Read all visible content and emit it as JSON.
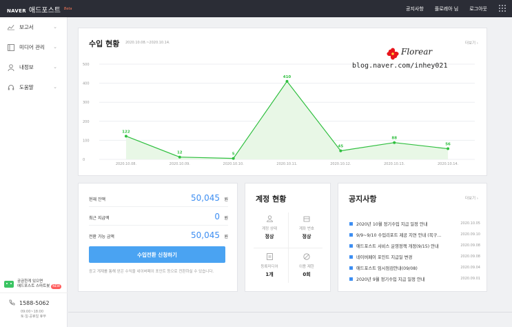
{
  "header": {
    "brand_naver": "NAVER",
    "brand_service": "애드포스트",
    "brand_beta": "Beta",
    "nav": [
      "공지사항",
      "플로레아 님",
      "로그아웃"
    ]
  },
  "sidebar": {
    "items": [
      {
        "label": "보고서",
        "icon": "chart-line-icon"
      },
      {
        "label": "미디어 관리",
        "icon": "media-icon"
      },
      {
        "label": "내정보",
        "icon": "user-icon"
      },
      {
        "label": "도움말",
        "icon": "headset-icon"
      }
    ],
    "robot_line1": "궁금한게 있으면",
    "robot_line2": "애드포스트 스마트봇",
    "robot_badge": "NEW",
    "phone": "1588-5062",
    "hours_line1": "09:00~18:00",
    "hours_line2": "토·일·공휴일 휴무"
  },
  "revenue": {
    "title": "수입 현황",
    "period": "2020.10.08.~2020.10.14.",
    "more": "더보기"
  },
  "watermark": {
    "name": "Florear",
    "blog": "blog.naver.com/inhey021"
  },
  "chart_data": {
    "type": "area",
    "x": [
      "2020.10.08.",
      "2020.10.09.",
      "2020.10.10.",
      "2020.10.11.",
      "2020.10.12.",
      "2020.10.13.",
      "2020.10.14."
    ],
    "series": [
      {
        "values": [
          122,
          12,
          5,
          410,
          45,
          88,
          56
        ]
      }
    ],
    "y_ticks": [
      "0",
      "100",
      "200",
      "300",
      "400",
      "500"
    ],
    "ylim": [
      0,
      500
    ],
    "grid": true,
    "colors": {
      "line": "#2fbf3f",
      "fill": "#e8f7e6",
      "label": "#2fbf3f"
    }
  },
  "balance": {
    "rows": [
      {
        "label": "현재 잔액",
        "value": "50,045",
        "unit": "원"
      },
      {
        "label": "최근 지급액",
        "value": "0",
        "unit": "원"
      },
      {
        "label": "전환 가능 금액",
        "value": "50,045",
        "unit": "원"
      }
    ],
    "button": "수입전환 신청하기",
    "note": "광고 게재를 통해 얻은 수익을 네이버페이 포인트 등으로 전환하실 수 있습니다."
  },
  "account": {
    "title": "계정 현황",
    "cells": [
      {
        "label": "계정 상태",
        "value": "정상",
        "icon": "person-icon"
      },
      {
        "label": "계좌 번호",
        "value": "정상",
        "icon": "card-icon"
      },
      {
        "label": "등록미디어",
        "value": "1개",
        "icon": "document-icon"
      },
      {
        "label": "이용 제한",
        "value": "0회",
        "icon": "ban-icon"
      }
    ]
  },
  "notices": {
    "title": "공지사항",
    "more": "더보기",
    "items": [
      {
        "title": "2020년 10월 정기수입 지급 일정 안내",
        "date": "2020.10.05"
      },
      {
        "title": "9/9~9/10 수입리포트 제공 지연 안내 (복구…",
        "date": "2020.09.10"
      },
      {
        "title": "애드포스트 서비스 운영정책 개정(9/15) 안내",
        "date": "2020.09.08"
      },
      {
        "title": "네이버페이 포인트 지급일 변경",
        "date": "2020.09.08"
      },
      {
        "title": "애드포스트 임시점검안내(09/08)",
        "date": "2020.09.04"
      },
      {
        "title": "2020년 9월 정기수입 지급 일정 안내",
        "date": "2020.09.01"
      }
    ]
  }
}
